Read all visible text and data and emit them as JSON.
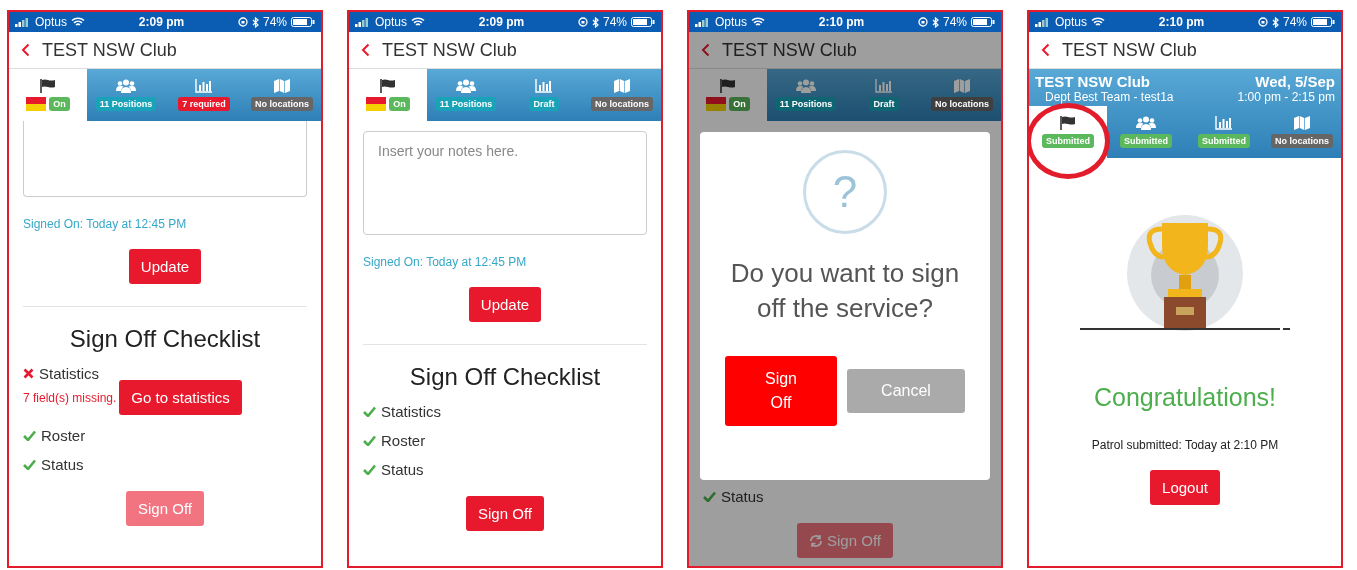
{
  "screens": [
    {
      "status_bar": {
        "carrier": "Optus",
        "time": "2:09 pm",
        "battery": "74%"
      },
      "title": "TEST NSW Club",
      "tabs": [
        {
          "swatch": true,
          "badge": "On",
          "color": "#5cb85c",
          "selected": true,
          "circled": false
        },
        {
          "swatch": false,
          "badge": "11 Positions",
          "color": "#1aa3b8",
          "selected": false,
          "circled": false
        },
        {
          "swatch": false,
          "badge": "7 required",
          "color": "#e8192c",
          "selected": false,
          "circled": false
        },
        {
          "swatch": false,
          "badge": "No locations",
          "color": "#666666",
          "selected": false,
          "circled": false
        }
      ],
      "sections": [
        {
          "kind": "notes",
          "cut": true
        },
        {
          "kind": "signed_on",
          "text": "Signed On: Today at 12:45 PM"
        },
        {
          "kind": "button",
          "label": "Update",
          "disabled": false,
          "spinner": false
        },
        {
          "kind": "divider"
        },
        {
          "kind": "heading",
          "text": "Sign Off Checklist"
        },
        {
          "kind": "check",
          "label": "Statistics",
          "passed": false,
          "note": "7 field(s) missing.",
          "action": "Go to statistics"
        },
        {
          "kind": "check",
          "label": "Roster",
          "passed": true
        },
        {
          "kind": "check",
          "label": "Status",
          "passed": true
        },
        {
          "kind": "button",
          "label": "Sign Off",
          "disabled": true,
          "spinner": false
        }
      ]
    },
    {
      "status_bar": {
        "carrier": "Optus",
        "time": "2:09 pm",
        "battery": "74%"
      },
      "title": "TEST NSW Club",
      "tabs": [
        {
          "swatch": true,
          "badge": "On",
          "color": "#5cb85c",
          "selected": true,
          "circled": false
        },
        {
          "swatch": false,
          "badge": "11 Positions",
          "color": "#1aa3b8",
          "selected": false,
          "circled": false
        },
        {
          "swatch": false,
          "badge": "Draft",
          "color": "#1aa3b8",
          "selected": false,
          "circled": false
        },
        {
          "swatch": false,
          "badge": "No locations",
          "color": "#666666",
          "selected": false,
          "circled": false
        }
      ],
      "sections": [
        {
          "kind": "notes",
          "cut": false,
          "placeholder": "Insert your notes here."
        },
        {
          "kind": "signed_on",
          "text": "Signed On: Today at 12:45 PM"
        },
        {
          "kind": "button",
          "label": "Update",
          "disabled": false,
          "spinner": false
        },
        {
          "kind": "divider"
        },
        {
          "kind": "heading",
          "text": "Sign Off Checklist"
        },
        {
          "kind": "check",
          "label": "Statistics",
          "passed": true
        },
        {
          "kind": "check",
          "label": "Roster",
          "passed": true
        },
        {
          "kind": "check",
          "label": "Status",
          "passed": true
        },
        {
          "kind": "button",
          "label": "Sign Off",
          "disabled": false,
          "spinner": false
        }
      ]
    },
    {
      "status_bar": {
        "carrier": "Optus",
        "time": "2:10 pm",
        "battery": "74%"
      },
      "title": "TEST NSW Club",
      "tabs": [
        {
          "swatch": true,
          "badge": "On",
          "color": "#397239",
          "selected": true,
          "circled": false
        },
        {
          "swatch": false,
          "badge": "11 Positions",
          "color": "#106572",
          "selected": false,
          "circled": false
        },
        {
          "swatch": false,
          "badge": "Draft",
          "color": "#106572",
          "selected": false,
          "circled": false
        },
        {
          "swatch": false,
          "badge": "No locations",
          "color": "#3f3f3f",
          "selected": false,
          "circled": false
        }
      ],
      "sections": [
        {
          "kind": "check",
          "label": "Status",
          "passed": true
        },
        {
          "kind": "button",
          "label": "Sign Off",
          "disabled": true,
          "spinner": true
        }
      ],
      "dialog": {
        "symbol": "?",
        "message": "Do you want to sign off the service?",
        "buttons": [
          {
            "label": "Sign Off",
            "kind": "primary"
          },
          {
            "label": "Cancel",
            "kind": "secondary"
          }
        ]
      }
    },
    {
      "status_bar": {
        "carrier": "Optus",
        "time": "2:10 pm",
        "battery": "74%"
      },
      "title": "TEST NSW Club",
      "club_info": {
        "name": "TEST NSW Club",
        "date": "Wed, 5/Sep",
        "team": "Dept Best Team - test1a",
        "time": "1:00 pm - 2:15 pm"
      },
      "tabs": [
        {
          "swatch": false,
          "badge": "Submitted",
          "color": "#5cb85c",
          "selected": true,
          "circled": true
        },
        {
          "swatch": false,
          "badge": "Submitted",
          "color": "#5cb85c",
          "selected": false,
          "circled": false
        },
        {
          "swatch": false,
          "badge": "Submitted",
          "color": "#5cb85c",
          "selected": false,
          "circled": false
        },
        {
          "swatch": false,
          "badge": "No locations",
          "color": "#666666",
          "selected": false,
          "circled": false
        }
      ],
      "sections": [
        {
          "kind": "trophy"
        },
        {
          "kind": "congrats",
          "text": "Congratulations!"
        },
        {
          "kind": "text",
          "text": "Patrol submitted: Today at 2:10 PM"
        },
        {
          "kind": "button",
          "label": "Logout",
          "disabled": false,
          "spinner": false
        }
      ]
    }
  ]
}
